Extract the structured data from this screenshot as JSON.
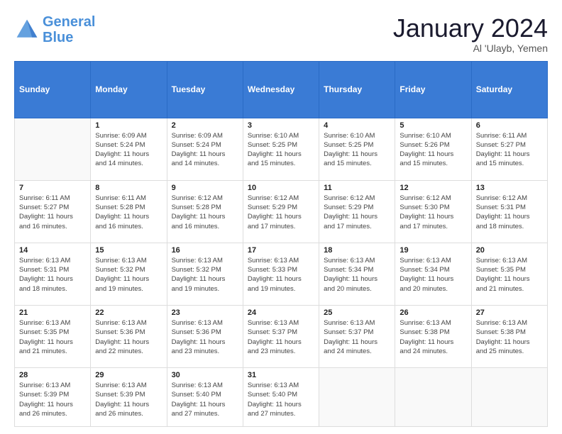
{
  "header": {
    "logo_line1": "General",
    "logo_line2": "Blue",
    "month_title": "January 2024",
    "subtitle": "Al 'Ulayb, Yemen"
  },
  "days_of_week": [
    "Sunday",
    "Monday",
    "Tuesday",
    "Wednesday",
    "Thursday",
    "Friday",
    "Saturday"
  ],
  "weeks": [
    [
      {
        "day": "",
        "info": ""
      },
      {
        "day": "1",
        "info": "Sunrise: 6:09 AM\nSunset: 5:24 PM\nDaylight: 11 hours\nand 14 minutes."
      },
      {
        "day": "2",
        "info": "Sunrise: 6:09 AM\nSunset: 5:24 PM\nDaylight: 11 hours\nand 14 minutes."
      },
      {
        "day": "3",
        "info": "Sunrise: 6:10 AM\nSunset: 5:25 PM\nDaylight: 11 hours\nand 15 minutes."
      },
      {
        "day": "4",
        "info": "Sunrise: 6:10 AM\nSunset: 5:25 PM\nDaylight: 11 hours\nand 15 minutes."
      },
      {
        "day": "5",
        "info": "Sunrise: 6:10 AM\nSunset: 5:26 PM\nDaylight: 11 hours\nand 15 minutes."
      },
      {
        "day": "6",
        "info": "Sunrise: 6:11 AM\nSunset: 5:27 PM\nDaylight: 11 hours\nand 15 minutes."
      }
    ],
    [
      {
        "day": "7",
        "info": "Sunrise: 6:11 AM\nSunset: 5:27 PM\nDaylight: 11 hours\nand 16 minutes."
      },
      {
        "day": "8",
        "info": "Sunrise: 6:11 AM\nSunset: 5:28 PM\nDaylight: 11 hours\nand 16 minutes."
      },
      {
        "day": "9",
        "info": "Sunrise: 6:12 AM\nSunset: 5:28 PM\nDaylight: 11 hours\nand 16 minutes."
      },
      {
        "day": "10",
        "info": "Sunrise: 6:12 AM\nSunset: 5:29 PM\nDaylight: 11 hours\nand 17 minutes."
      },
      {
        "day": "11",
        "info": "Sunrise: 6:12 AM\nSunset: 5:29 PM\nDaylight: 11 hours\nand 17 minutes."
      },
      {
        "day": "12",
        "info": "Sunrise: 6:12 AM\nSunset: 5:30 PM\nDaylight: 11 hours\nand 17 minutes."
      },
      {
        "day": "13",
        "info": "Sunrise: 6:12 AM\nSunset: 5:31 PM\nDaylight: 11 hours\nand 18 minutes."
      }
    ],
    [
      {
        "day": "14",
        "info": "Sunrise: 6:13 AM\nSunset: 5:31 PM\nDaylight: 11 hours\nand 18 minutes."
      },
      {
        "day": "15",
        "info": "Sunrise: 6:13 AM\nSunset: 5:32 PM\nDaylight: 11 hours\nand 19 minutes."
      },
      {
        "day": "16",
        "info": "Sunrise: 6:13 AM\nSunset: 5:32 PM\nDaylight: 11 hours\nand 19 minutes."
      },
      {
        "day": "17",
        "info": "Sunrise: 6:13 AM\nSunset: 5:33 PM\nDaylight: 11 hours\nand 19 minutes."
      },
      {
        "day": "18",
        "info": "Sunrise: 6:13 AM\nSunset: 5:34 PM\nDaylight: 11 hours\nand 20 minutes."
      },
      {
        "day": "19",
        "info": "Sunrise: 6:13 AM\nSunset: 5:34 PM\nDaylight: 11 hours\nand 20 minutes."
      },
      {
        "day": "20",
        "info": "Sunrise: 6:13 AM\nSunset: 5:35 PM\nDaylight: 11 hours\nand 21 minutes."
      }
    ],
    [
      {
        "day": "21",
        "info": "Sunrise: 6:13 AM\nSunset: 5:35 PM\nDaylight: 11 hours\nand 21 minutes."
      },
      {
        "day": "22",
        "info": "Sunrise: 6:13 AM\nSunset: 5:36 PM\nDaylight: 11 hours\nand 22 minutes."
      },
      {
        "day": "23",
        "info": "Sunrise: 6:13 AM\nSunset: 5:36 PM\nDaylight: 11 hours\nand 23 minutes."
      },
      {
        "day": "24",
        "info": "Sunrise: 6:13 AM\nSunset: 5:37 PM\nDaylight: 11 hours\nand 23 minutes."
      },
      {
        "day": "25",
        "info": "Sunrise: 6:13 AM\nSunset: 5:37 PM\nDaylight: 11 hours\nand 24 minutes."
      },
      {
        "day": "26",
        "info": "Sunrise: 6:13 AM\nSunset: 5:38 PM\nDaylight: 11 hours\nand 24 minutes."
      },
      {
        "day": "27",
        "info": "Sunrise: 6:13 AM\nSunset: 5:38 PM\nDaylight: 11 hours\nand 25 minutes."
      }
    ],
    [
      {
        "day": "28",
        "info": "Sunrise: 6:13 AM\nSunset: 5:39 PM\nDaylight: 11 hours\nand 26 minutes."
      },
      {
        "day": "29",
        "info": "Sunrise: 6:13 AM\nSunset: 5:39 PM\nDaylight: 11 hours\nand 26 minutes."
      },
      {
        "day": "30",
        "info": "Sunrise: 6:13 AM\nSunset: 5:40 PM\nDaylight: 11 hours\nand 27 minutes."
      },
      {
        "day": "31",
        "info": "Sunrise: 6:13 AM\nSunset: 5:40 PM\nDaylight: 11 hours\nand 27 minutes."
      },
      {
        "day": "",
        "info": ""
      },
      {
        "day": "",
        "info": ""
      },
      {
        "day": "",
        "info": ""
      }
    ]
  ]
}
